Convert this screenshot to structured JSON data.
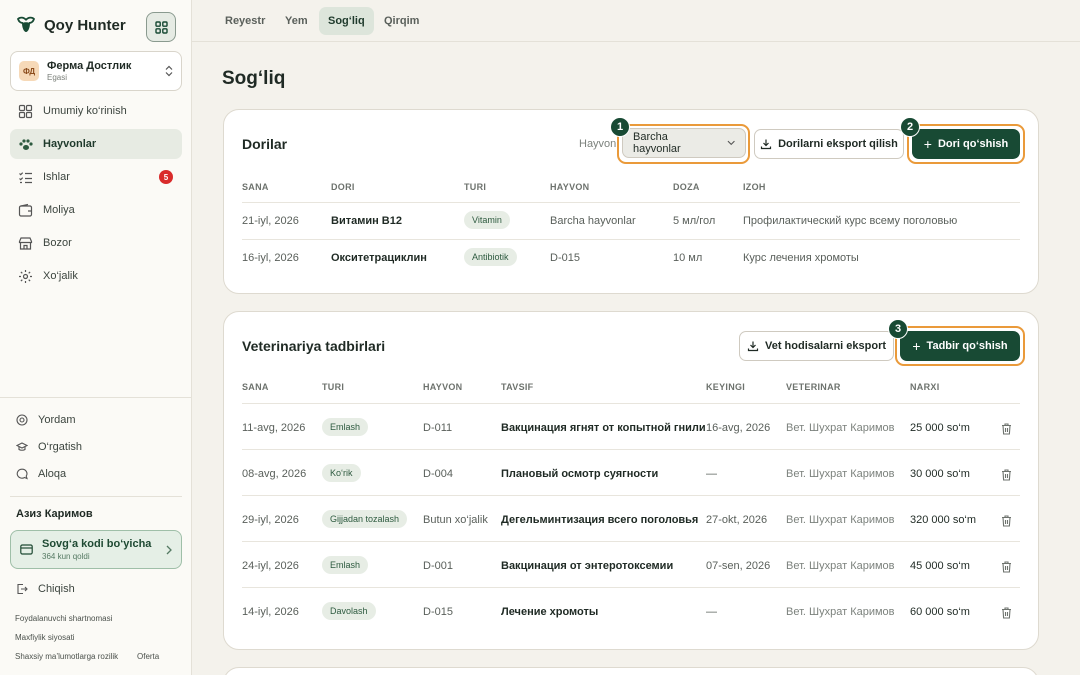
{
  "app": {
    "name": "Qoy Hunter"
  },
  "farm": {
    "initials": "ФД",
    "name": "Ферма Достлик",
    "role": "Egasi"
  },
  "sidebar": {
    "items": [
      {
        "label": "Umumiy ko‘rinish"
      },
      {
        "label": "Hayvonlar"
      },
      {
        "label": "Ishlar",
        "badge": "5"
      },
      {
        "label": "Moliya"
      },
      {
        "label": "Bozor"
      },
      {
        "label": "Xo‘jalik"
      }
    ],
    "footer": [
      {
        "label": "Yordam"
      },
      {
        "label": "O‘rgatish"
      },
      {
        "label": "Aloqa"
      }
    ],
    "user": "Азиз Каримов",
    "gift": {
      "title": "Sovg‘a kodi bo‘yicha",
      "subtitle": "364 kun qoldi"
    },
    "logout": "Chiqish",
    "legal": [
      "Foydalanuvchi shartnomasi",
      "Maxfiylik siyosati",
      "Shaxsiy ma’lumotlarga rozilik",
      "Oferta"
    ]
  },
  "tabs": [
    "Reyestr",
    "Yem",
    "Sog‘liq",
    "Qirqim"
  ],
  "page": {
    "title": "Sog‘liq"
  },
  "medicines": {
    "title": "Dorilar",
    "filter_label": "Hayvon",
    "filter_value": "Barcha hayvonlar",
    "export_label": "Dorilarni eksport qilish",
    "add_label": "Dori qo‘shish",
    "columns": [
      "SANA",
      "DORI",
      "TURI",
      "HAYVON",
      "DOZA",
      "IZOH"
    ],
    "rows": [
      {
        "date": "21-iyl, 2026",
        "drug": "Витамин B12",
        "type": "Vitamin",
        "animal": "Barcha hayvonlar",
        "dose": "5 мл/гол",
        "note": "Профилактический курс всему поголовью"
      },
      {
        "date": "16-iyl, 2026",
        "drug": "Окситетрациклин",
        "type": "Antibiotik",
        "animal": "D-015",
        "dose": "10 мл",
        "note": "Курс лечения хромоты"
      }
    ]
  },
  "vet": {
    "title": "Veterinariya tadbirlari",
    "export_label": "Vet hodisalarni eksport",
    "add_label": "Tadbir qo‘shish",
    "columns": [
      "SANA",
      "TURI",
      "HAYVON",
      "TAVSIF",
      "KEYINGI",
      "VETERINAR",
      "NARXI"
    ],
    "rows": [
      {
        "date": "11-avg, 2026",
        "type": "Emlash",
        "animal": "D-011",
        "desc": "Вакцинация ягнят от копытной гнили",
        "next": "16-avg, 2026",
        "vet": "Вет. Шухрат Каримов",
        "price": "25 000 so‘m"
      },
      {
        "date": "08-avg, 2026",
        "type": "Ko‘rik",
        "animal": "D-004",
        "desc": "Плановый осмотр суягности",
        "next": "—",
        "vet": "Вет. Шухрат Каримов",
        "price": "30 000 so‘m"
      },
      {
        "date": "29-iyl, 2026",
        "type": "Gijjadan tozalash",
        "animal": "Butun xo‘jalik",
        "desc": "Дегельминтизация всего поголовья",
        "next": "27-okt, 2026",
        "vet": "Вет. Шухрат Каримов",
        "price": "320 000 so‘m"
      },
      {
        "date": "24-iyl, 2026",
        "type": "Emlash",
        "animal": "D-001",
        "desc": "Вакцинация от энтеротоксемии",
        "next": "07-sen, 2026",
        "vet": "Вет. Шухрат Каримов",
        "price": "45 000 so‘m"
      },
      {
        "date": "14-iyl, 2026",
        "type": "Davolash",
        "animal": "D-015",
        "desc": "Лечение хромоты",
        "next": "—",
        "vet": "Вет. Шухрат Каримов",
        "price": "60 000 so‘m"
      }
    ]
  },
  "markers": [
    "1",
    "2",
    "3"
  ],
  "colors": {
    "accent": "#184a34",
    "highlight": "#ea9a3a",
    "badge": "#d92b2b"
  }
}
